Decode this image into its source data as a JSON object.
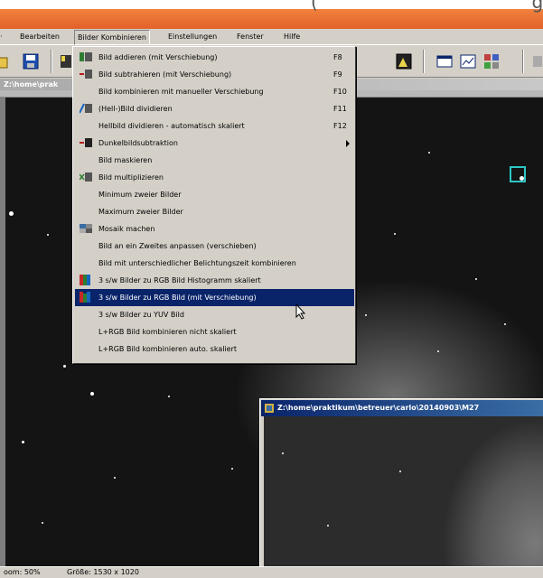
{
  "header_text": "(",
  "header_text_right": "g)",
  "menubar": {
    "items": [
      "Bearbeiten",
      "Bilder Kombinieren",
      "Einstellungen",
      "Fenster",
      "Hilfe"
    ]
  },
  "document1": {
    "title": "Z:\\home\\prak"
  },
  "document2": {
    "title": "Z:\\home\\praktikum\\betreuer\\carlo\\20140903\\M27"
  },
  "menu": {
    "title": "Bilder Kombinieren",
    "items": [
      {
        "label": "Bild addieren (mit Verschiebung)",
        "shortcut": "F8",
        "icon": "add-icon"
      },
      {
        "label": "Bild subtrahieren (mit Verschiebung)",
        "shortcut": "F9",
        "icon": "subtract-icon"
      },
      {
        "label": "Bild kombinieren mit manueller Verschiebung",
        "shortcut": "F10",
        "icon": ""
      },
      {
        "label": "(Hell-)Bild dividieren",
        "shortcut": "F11",
        "icon": "divide-icon"
      },
      {
        "label": "Hellbild dividieren - automatisch skaliert",
        "shortcut": "F12",
        "icon": ""
      },
      {
        "label": "Dunkelbildsubtraktion",
        "shortcut": "",
        "icon": "dark-subtract-icon",
        "submenu": true
      },
      {
        "label": "Bild maskieren",
        "shortcut": "",
        "icon": ""
      },
      {
        "label": "Bild multiplizieren",
        "shortcut": "",
        "icon": "multiply-icon"
      },
      {
        "label": "Minimum zweier Bilder",
        "shortcut": "",
        "icon": ""
      },
      {
        "label": "Maximum zweier Bilder",
        "shortcut": "",
        "icon": ""
      },
      {
        "label": "Mosaik machen",
        "shortcut": "",
        "icon": "mosaic-icon"
      },
      {
        "label": "Bild an ein Zweites anpassen (verschieben)",
        "shortcut": "",
        "icon": ""
      },
      {
        "label": "Bild mit unterschiedlicher Belichtungszeit kombinieren",
        "shortcut": "",
        "icon": ""
      },
      {
        "label": "3 s/w Bilder zu RGB Bild Histogramm skaliert",
        "shortcut": "",
        "icon": "rgb-icon"
      },
      {
        "label": "3 s/w Bilder zu RGB Bild (mit Verschiebung)",
        "shortcut": "",
        "icon": "rgb-shift-icon",
        "highlighted": true
      },
      {
        "label": "3 s/w Bilder zu YUV Bild",
        "shortcut": "",
        "icon": ""
      },
      {
        "label": "L+RGB Bild kombinieren nicht skaliert",
        "shortcut": "",
        "icon": ""
      },
      {
        "label": "L+RGB Bild kombinieren auto. skaliert",
        "shortcut": "",
        "icon": ""
      }
    ]
  },
  "status": {
    "zoom": "oom: 50%",
    "size": "Größe: 1530 x 1020"
  },
  "colors": {
    "accent_orange": "#e96f34",
    "highlight": "#0a246a",
    "marker": "#2ec6c6"
  }
}
